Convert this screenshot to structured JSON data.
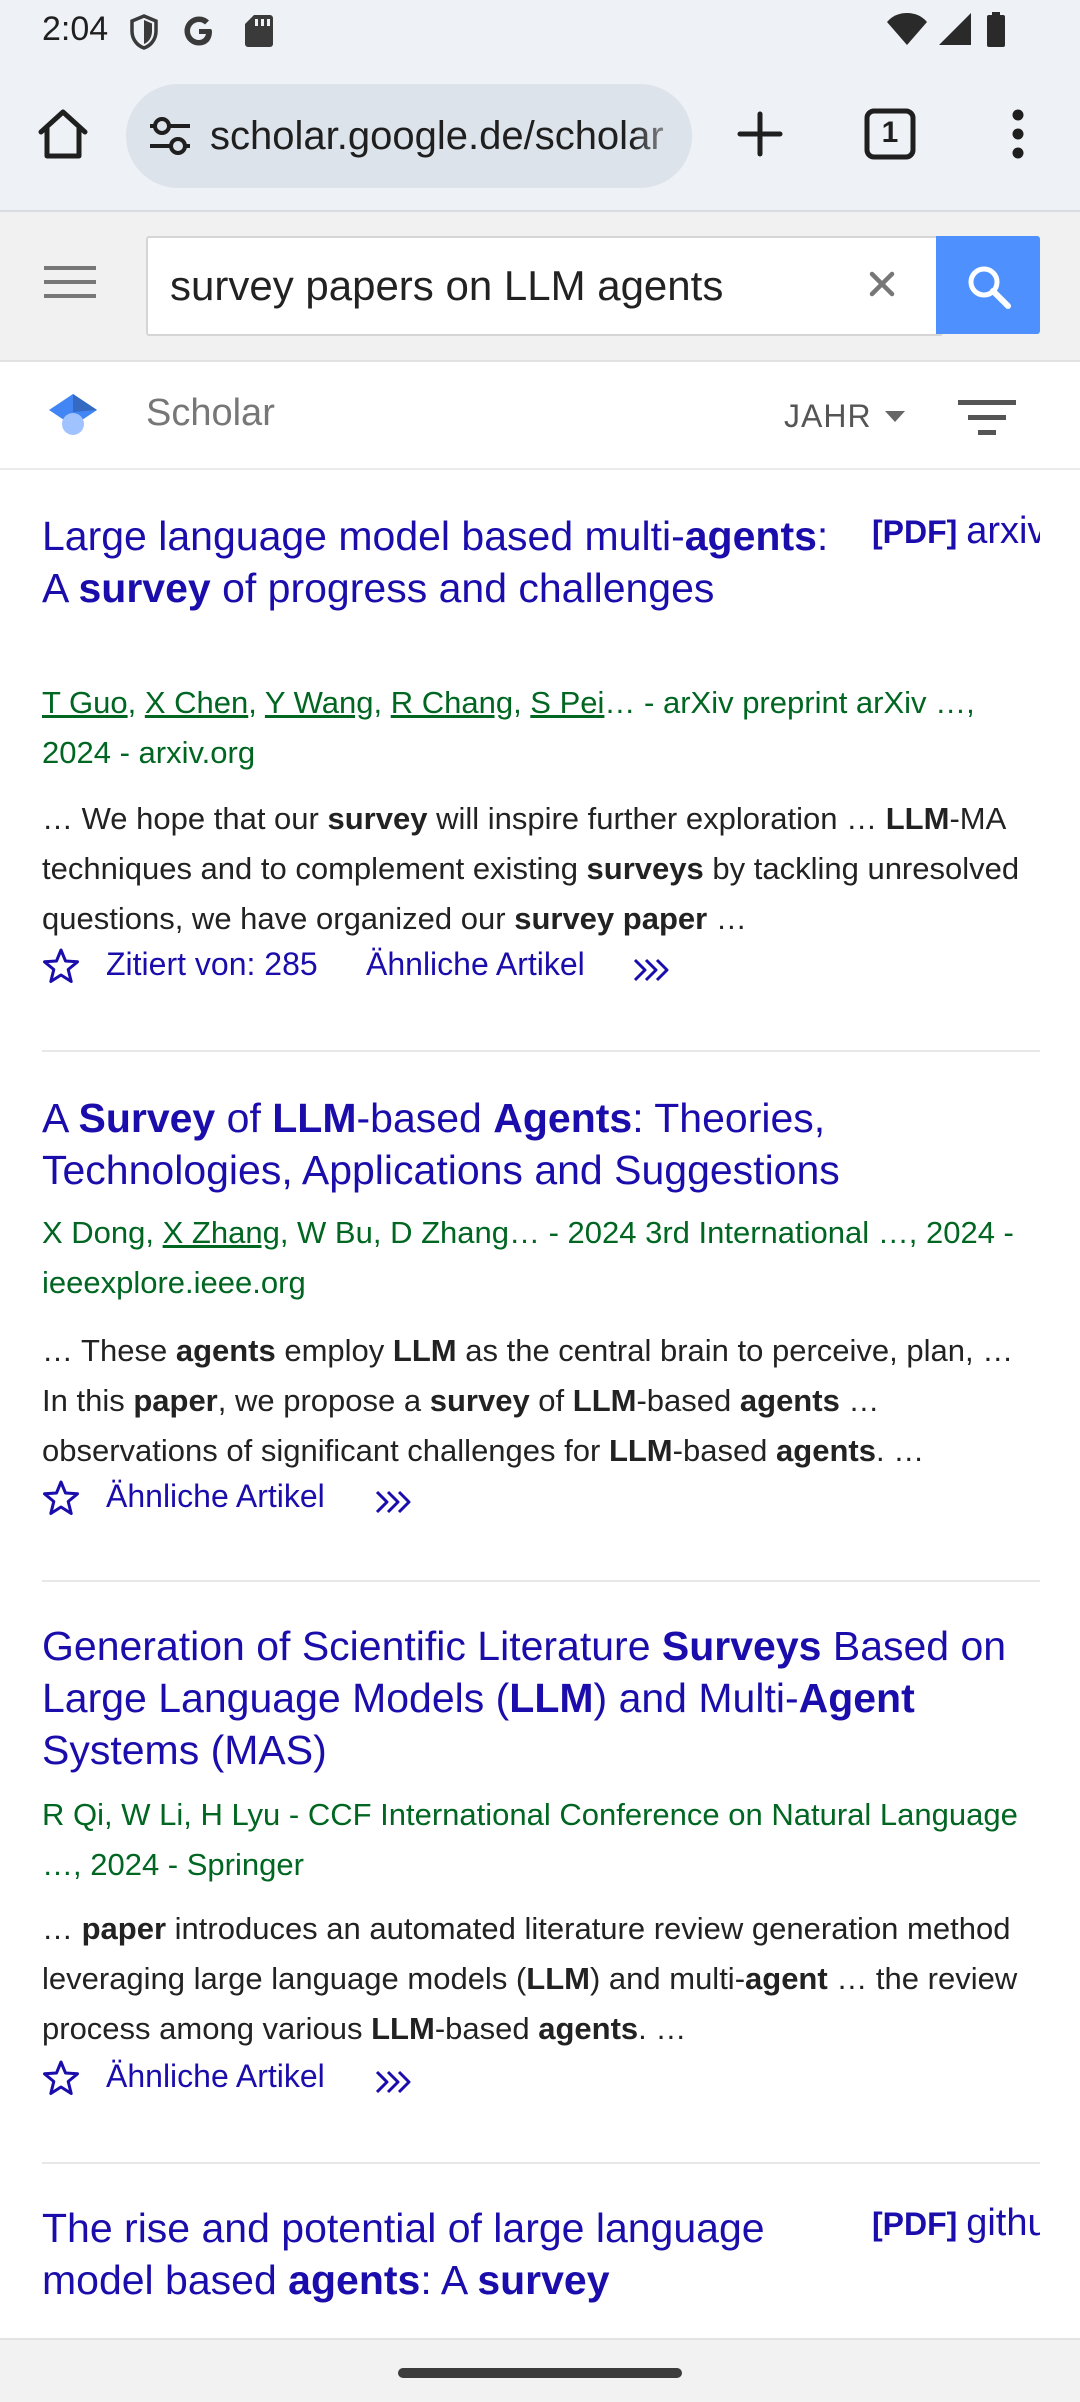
{
  "status_bar": {
    "time": "2:04",
    "icons": [
      "shield-icon",
      "google-g-icon",
      "sd-card-icon",
      "wifi-icon",
      "signal-icon",
      "battery-icon"
    ]
  },
  "browser": {
    "url": "scholar.google.de/scholar",
    "tab_count": "1",
    "icons": [
      "home-icon",
      "site-settings-icon",
      "new-tab-plus-icon",
      "tab-switcher-icon",
      "overflow-menu-icon"
    ]
  },
  "search": {
    "query": "survey papers on LLM agents",
    "clear_label": "×"
  },
  "scholar_nav": {
    "title": "Scholar",
    "year_label": "JAHR"
  },
  "results": [
    {
      "title_parts": [
        {
          "t": "Large language model based multi-",
          "b": false
        },
        {
          "t": "agents",
          "b": true
        },
        {
          "t": ": A ",
          "b": false
        },
        {
          "t": "survey",
          "b": true
        },
        {
          "t": " of progress and challenges",
          "b": false
        }
      ],
      "pdf_tag": "[PDF]",
      "pdf_host": "arxiv.org",
      "meta_authors": [
        {
          "t": "T Guo",
          "u": true
        },
        {
          "t": ", ",
          "u": false
        },
        {
          "t": "X Chen",
          "u": true
        },
        {
          "t": ", ",
          "u": false
        },
        {
          "t": "Y Wang",
          "u": true
        },
        {
          "t": ", ",
          "u": false
        },
        {
          "t": "R Chang",
          "u": true
        },
        {
          "t": ", ",
          "u": false
        },
        {
          "t": "S Pei",
          "u": true
        },
        {
          "t": "… - arXiv preprint arXiv …, 2024 - arxiv.org",
          "u": false
        }
      ],
      "snippet_parts": [
        {
          "t": "… We hope that our ",
          "b": false
        },
        {
          "t": "survey",
          "b": true
        },
        {
          "t": " will inspire further exploration … ",
          "b": false
        },
        {
          "t": "LLM",
          "b": true
        },
        {
          "t": "-MA techniques and to complement existing ",
          "b": false
        },
        {
          "t": "surveys",
          "b": true
        },
        {
          "t": " by tackling unresolved questions, we have organized our ",
          "b": false
        },
        {
          "t": "survey paper",
          "b": true
        },
        {
          "t": " …",
          "b": false
        }
      ],
      "cited_by": "Zitiert von: 285",
      "related": "Ähnliche Artikel"
    },
    {
      "title_parts": [
        {
          "t": "A ",
          "b": false
        },
        {
          "t": "Survey",
          "b": true
        },
        {
          "t": " of ",
          "b": false
        },
        {
          "t": "LLM",
          "b": true
        },
        {
          "t": "-based ",
          "b": false
        },
        {
          "t": "Agents",
          "b": true
        },
        {
          "t": ": Theories, Technologies, Applications and Suggestions",
          "b": false
        }
      ],
      "meta_authors": [
        {
          "t": "X Dong, ",
          "u": false
        },
        {
          "t": "X Zhang",
          "u": true
        },
        {
          "t": ", W Bu, D Zhang… - 2024 3rd International …, 2024 - ieeexplore.ieee.org",
          "u": false
        }
      ],
      "snippet_parts": [
        {
          "t": "… These ",
          "b": false
        },
        {
          "t": "agents",
          "b": true
        },
        {
          "t": " employ ",
          "b": false
        },
        {
          "t": "LLM",
          "b": true
        },
        {
          "t": " as the central brain to perceive, plan, … In this ",
          "b": false
        },
        {
          "t": "paper",
          "b": true
        },
        {
          "t": ", we propose a ",
          "b": false
        },
        {
          "t": "survey",
          "b": true
        },
        {
          "t": " of ",
          "b": false
        },
        {
          "t": "LLM",
          "b": true
        },
        {
          "t": "-based ",
          "b": false
        },
        {
          "t": "agents",
          "b": true
        },
        {
          "t": " … observations of significant challenges for ",
          "b": false
        },
        {
          "t": "LLM",
          "b": true
        },
        {
          "t": "-based ",
          "b": false
        },
        {
          "t": "agents",
          "b": true
        },
        {
          "t": ". …",
          "b": false
        }
      ],
      "related": "Ähnliche Artikel"
    },
    {
      "title_parts": [
        {
          "t": "Generation of Scientific Literature ",
          "b": false
        },
        {
          "t": "Surveys",
          "b": true
        },
        {
          "t": " Based on Large Language Models (",
          "b": false
        },
        {
          "t": "LLM",
          "b": true
        },
        {
          "t": ") and Multi-",
          "b": false
        },
        {
          "t": "Agent",
          "b": true
        },
        {
          "t": " Systems (MAS)",
          "b": false
        }
      ],
      "meta_authors": [
        {
          "t": "R Qi, W Li, H Lyu - CCF International Conference on Natural Language …, 2024 - Springer",
          "u": false
        }
      ],
      "snippet_parts": [
        {
          "t": "… ",
          "b": false
        },
        {
          "t": "paper",
          "b": true
        },
        {
          "t": " introduces an automated literature review generation method leveraging large language models (",
          "b": false
        },
        {
          "t": "LLM",
          "b": true
        },
        {
          "t": ") and multi-",
          "b": false
        },
        {
          "t": "agent",
          "b": true
        },
        {
          "t": " … the review process among various ",
          "b": false
        },
        {
          "t": "LLM",
          "b": true
        },
        {
          "t": "-based ",
          "b": false
        },
        {
          "t": "agents",
          "b": true
        },
        {
          "t": ". …",
          "b": false
        }
      ],
      "related": "Ähnliche Artikel"
    },
    {
      "title_parts": [
        {
          "t": "The rise and potential of large language model based ",
          "b": false
        },
        {
          "t": "agents",
          "b": true
        },
        {
          "t": ": A ",
          "b": false
        },
        {
          "t": "survey",
          "b": true
        }
      ],
      "pdf_tag": "[PDF]",
      "pdf_host": "github.com"
    }
  ],
  "colors": {
    "link": "#1a0dab",
    "meta_green": "#006621",
    "search_button": "#4d90fe",
    "chrome_bg": "#eef1f6"
  }
}
